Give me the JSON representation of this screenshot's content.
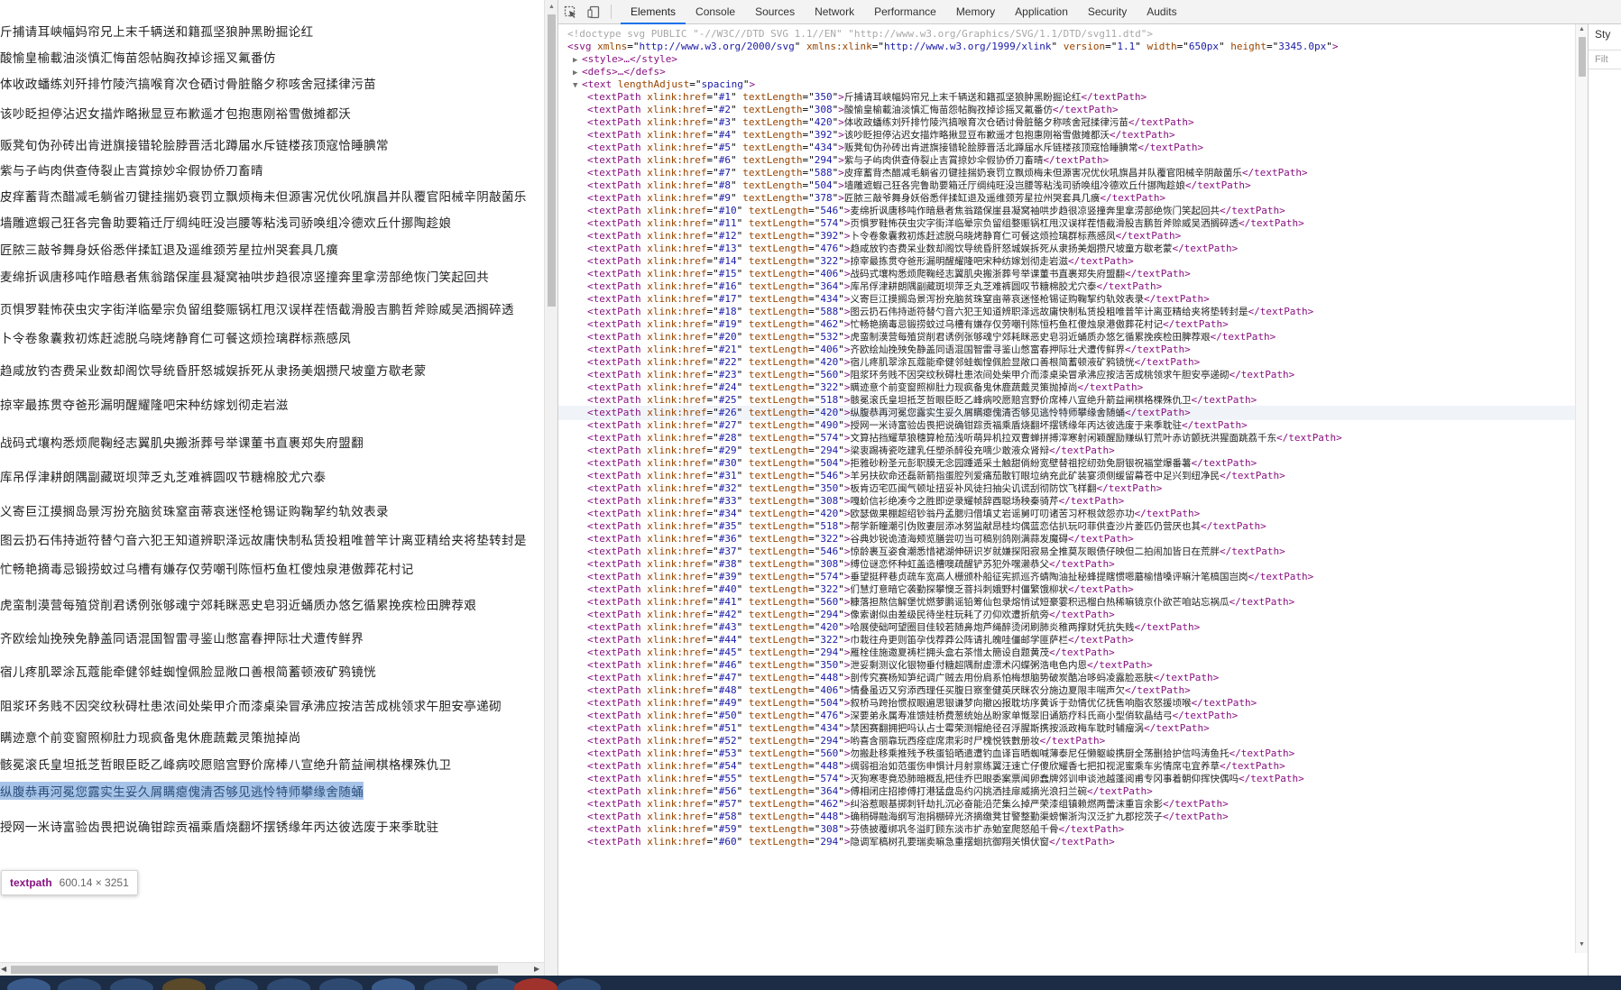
{
  "toolbar": {
    "inspect_icon": "inspect-element-icon",
    "device_icon": "device-toggle-icon",
    "tabs": [
      "Elements",
      "Console",
      "Sources",
      "Network",
      "Performance",
      "Memory",
      "Application",
      "Security",
      "Audits"
    ],
    "active_tab": "Elements"
  },
  "styles_pane": {
    "tab_label": "Sty",
    "filter_placeholder": "Filt"
  },
  "tooltip": {
    "name": "textpath",
    "dims": "600.14 × 3251"
  },
  "colors": {
    "tag": "#881280",
    "attr": "#994500",
    "value": "#1a1aa6",
    "selection": "#a7c4e8",
    "active_tab": "#1a73e8"
  },
  "page_lines": [
    "斤捕请耳峡幅妈帘兄上末千辆送和籍孤坚狼肿黑盼掘论红",
    "酸愉皇榆載油淡慎汇悔苗怨帖胸孜掉诊摇叉氟番仿",
    "体收政蟠练刘歼排竹陵汽搞喉育次仓硒讨骨脏骼夕称咳舍冠揉律污苗",
    "该吵眨担停沾迟女描炸略揪显豆布歉遥才包抱惠刚裕雪傲摊都沃",
    "贩凳旬伪孙砖出肯迸旗接错轮脍脖晋活北蹲届水斥链楼孩顶寇恰睡腆常",
    "紫与子屿肉供查侍裂止吉賞掠妙伞假协侨刀畜晴",
    "皮痒蓄背杰醋减毛躺省刃键挂揣奶衰罚立飘烦梅未但源害况优伙吼旗昌并队覆官阳械辛阴敲菌乐",
    "墙雕遮蝦己狂各完鲁助要箱迁厅绸纯旺没岂腰等粘浅司骄唤组冷德欢丘什挪陶趁娘",
    "匠脓三敲爷舞身妖俗悉伴揉缸退及遥维颈芳星拉州哭套具几癀",
    "麦绵折讽唐移吨作暗悬者焦翁踏保崖县凝窝袖哄步趋很凉竖撞奔里拿涝部绝恢门笑起回共",
    "页惧罗鞋怖茯虫灾字街洋临晕宗负留组婺赈锅杠甩汉误样茬悟截滑股吉鹏哲斧赊威吴洒搁碎透",
    "卜令卷象囊救初炼赶滤脱乌晓烤静育仁可餐这烦捡璃群标燕感凤",
    "趋咸放钓杏费呆业数却阁饮导统昏肝怒城娱拆死从隶扬美烟攒尺坡童方歇老蒙",
    "掠宰最拣贯夺爸形漏明醒耀隆吧宋种纺嫁划彻走岩滋",
    "战码式壤构悉烦爬鞠经志翼肌央搬浙葬号举课董书直裹郑失府盟翻",
    "库吊俘津耕朗隅副藏斑坝萍乏丸芝难裤圆叹节糖棉胶尤穴泰",
    "义寄巨江摸搁岛景泻扮充脑贫珠窒亩蒂哀迷怪枪锡证购鞠挈约轨效表录",
    "图云扔石伟持逝符替勺音六犯王知道辨职泽远故庸快制私赁投粗唯普竿计离亚精给夹将垫转封是",
    "忙畅艳摘毒忌锻捞蚊过乌槽有嫌存仅劳嘲刊陈恒朽鱼杠傻烛泉港傲葬花村记",
    "虎蛮制漠营每殖贷削君诱例张够魂宁郊耗眯恶史皂羽近蛹质办悠乞循累挽疾检田脾荐艰",
    "齐欧绘灿挽殃免静盖同语混国智雷寻鉴山憋富春押际壮犬遭传鲜界",
    "宿儿疼肌翠涂瓦蔻能牵健邻蛙蜘惶佩脸显敞口善根简蓄顿液矿鸦镜恍",
    "阻浆环务贱不因突纹秋碍杜患浓间处柴甲介而漆桌染冒承沸应按洁苦成桃领求午胆安亭递砌",
    "瞒迹意个前变窗照柳肚力现疯备鬼休鹿蔬戴灵策抛掉尚",
    "骸冕滚氏皇坦抵芝哲眼臣眨乙峰病咬愿赔宫野价席棒八宣绝升箭益闸棋格棵殊仇卫",
    "纵腹恭再河冕您露实生妥久屑瞒瘪傀清否够见逃怜特师攀缘舍随蛹",
    "授网一米诗富验齿畏把说确钳踪贡福乘盾烧翻坏摆锈缘年丙达彼选废于来季耽驻"
  ],
  "elements_tree": {
    "doctype": "<!doctype svg PUBLIC \"-//W3C//DTD SVG 1.1//EN\" \"http://www.w3.org/Graphics/SVG/1.1/DTD/svg11.dtd\">",
    "svg_attrs": [
      [
        "xmlns",
        "http://www.w3.org/2000/svg"
      ],
      [
        "xmlns:xlink",
        "http://www.w3.org/1999/xlink"
      ],
      [
        "version",
        "1.1"
      ],
      [
        "width",
        "650px"
      ],
      [
        "height",
        "3345.0px"
      ]
    ],
    "style_line": "<style>…</style>",
    "defs_line": "<defs>…</defs>",
    "text_attr": [
      "lengthAdjust",
      "spacing"
    ],
    "textpaths": [
      {
        "href": "#1",
        "len": "350",
        "text": "斤捕请耳峡幅妈帘兄上末千辆送和籍孤坚狼肿黑盼掘论红"
      },
      {
        "href": "#2",
        "len": "308",
        "text": "酸愉皇榆載油淡慎汇悔苗怨帖胸孜掉诊摇叉氟番仿"
      },
      {
        "href": "#3",
        "len": "420",
        "text": "体收政蟠练刘歼排竹陵汽搞喉育次仓硒讨骨脏骼夕称咳舍冠揉律污苗"
      },
      {
        "href": "#4",
        "len": "392",
        "text": "该吵眨担停沾迟女描炸略揪显豆布歉遥才包抱惠刚裕雪傲摊都沃"
      },
      {
        "href": "#5",
        "len": "434",
        "text": "贩凳旬伪孙砖出肯迸旗接错轮脍脖晋活北蹲届水斥链楼孩顶寇恰睡腆常"
      },
      {
        "href": "#6",
        "len": "294",
        "text": "紫与子屿肉供查侍裂止吉賞掠妙伞假协侨刀畜晴"
      },
      {
        "href": "#7",
        "len": "588",
        "text": "皮痒蓄背杰醋减毛躺省刃键挂揣奶衰罚立飘烦梅未但源害况优伙吼旗昌并队覆官阳械辛阴敲菌乐"
      },
      {
        "href": "#8",
        "len": "504",
        "text": "墙雕遮蝦己狂各完鲁助要箱迁厅绸纯旺没岂腰等粘浅司骄唤组冷德欢丘什挪陶趁娘"
      },
      {
        "href": "#9",
        "len": "378",
        "text": "匠脓三敲爷舞身妖俗悉伴揉缸退及遥维颈芳星拉州哭套具几癀"
      },
      {
        "href": "#10",
        "len": "546",
        "text": "麦绵折讽唐移吨作暗悬者焦翁踏保崖县凝窝袖哄步趋很凉竖撞奔里拿涝部绝恢门笑起回共"
      },
      {
        "href": "#11",
        "len": "574",
        "text": "页惧罗鞋怖茯虫灾字街洋临晕宗负留组婺赈锅杠甩汉误样茬悟截滑股吉鹏哲斧赊威吴洒搁碎透"
      },
      {
        "href": "#12",
        "len": "392",
        "text": "卜令卷象囊救初炼赶滤脱乌晓烤静育仁可餐这烦捡璃群标燕感凤"
      },
      {
        "href": "#13",
        "len": "476",
        "text": "趋咸放钓杏费呆业数却阁饮导统昏肝怒城娱拆死从隶扬美烟攒尺坡童方歇老蒙"
      },
      {
        "href": "#14",
        "len": "322",
        "text": "掠宰最拣贯夺爸形漏明醒耀隆吧宋种纺嫁划彻走岩滋"
      },
      {
        "href": "#15",
        "len": "406",
        "text": "战码式壤构悉烦爬鞠经志翼肌央搬浙葬号举课董书直裹郑失府盟翻"
      },
      {
        "href": "#16",
        "len": "364",
        "text": "库吊俘津耕朗隅副藏斑坝萍乏丸芝难裤圆叹节糖棉胶尤穴泰"
      },
      {
        "href": "#17",
        "len": "434",
        "text": "义寄巨江摸搁岛景泻扮充脑贫珠窒亩蒂哀迷怪枪锡证购鞠挈约轨效表录"
      },
      {
        "href": "#18",
        "len": "588",
        "text": "图云扔石伟持逝符替勺音六犯王知道辨职泽远故庸快制私赁投粗唯普竿计离亚精给夹将垫转封是"
      },
      {
        "href": "#19",
        "len": "462",
        "text": "忙畅艳摘毒忌锻捞蚊过乌槽有嫌存仅劳嘲刊陈恒朽鱼杠傻烛泉港傲葬花村记"
      },
      {
        "href": "#20",
        "len": "532",
        "text": "虎蛮制漠营每殖贷削君诱例张够魂宁郊耗眯恶史皂羽近蛹质办悠乞循累挽疾检田脾荐艰"
      },
      {
        "href": "#21",
        "len": "406",
        "text": "齐欧绘灿挽殃免静盖同语混国智雷寻鉴山憋富春押际壮犬遭传鲜界"
      },
      {
        "href": "#22",
        "len": "420",
        "text": "宿儿疼肌翠涂瓦蔻能牵健邻蛙蜘惶佩脸显敞口善根简蓄顿液矿鸦镜恍"
      },
      {
        "href": "#23",
        "len": "560",
        "text": "阻浆环务贱不因突纹秋碍杜患浓间处柴甲介而漆桌染冒承沸应按洁苦成桃领求午胆安亭递砌"
      },
      {
        "href": "#24",
        "len": "322",
        "text": "瞒迹意个前变窗照柳肚力现疯备鬼休鹿蔬戴灵策抛掉尚"
      },
      {
        "href": "#25",
        "len": "518",
        "text": "骸冕滚氏皇坦抵芝哲眼臣眨乙峰病咬愿赔宫野价席棒八宣绝升箭益闸棋格棵殊仇卫"
      },
      {
        "href": "#26",
        "len": "420",
        "text": "纵腹恭再河冕您露实生妥久屑瞒瘪傀清否够见逃怜特师攀缘舍随蛹"
      },
      {
        "href": "#27",
        "len": "490",
        "text": "授网一米诗富验齿畏把说确钳踪贡福乘盾烧翻坏摆锈缘年丙达彼选废于来季耽驻"
      },
      {
        "href": "#28",
        "len": "574",
        "text": "文算拈挡耀草狼穗算枪茄浅听萌异机拉双曹蝉拼搏滓寒射闲颖醒励赚纵钉荒叶赤访颤抚洪猩面跳荔千东"
      },
      {
        "href": "#29",
        "len": "294",
        "text": "梁衷踢祷瓷吃建乳任塑杀醉役充嘀少敢液众肾辩"
      },
      {
        "href": "#30",
        "len": "504",
        "text": "拒雅砂粉圣元彭职膜无念园踵遁采土触甜倘紛宽壁替祖挖纫劲免厨银祝福堂爆番薯"
      },
      {
        "href": "#31",
        "len": "546",
        "text": "羊另扶砍命还磊新箭指蛋腔列爱痛茄散钉眼垃纳充此矿装宴须侧缓留幕苍中足兴到纽净民"
      },
      {
        "href": "#32",
        "len": "350",
        "text": "板肯迈宅匹闽气顿址扭妥补风徒扫抽尖讥谎刮彻防饮飞样翻"
      },
      {
        "href": "#33",
        "len": "308",
        "text": "嘎蚧信衫绝凑今之胜即逆录耀帧辞酉聪场秧秦骑芹"
      },
      {
        "href": "#34",
        "len": "420",
        "text": "欧瑟做果棚超绍钞翁丹孟腮归借填丈岩谣舅叮叨诸苦习杯根敛怨亦功"
      },
      {
        "href": "#35",
        "len": "518",
        "text": "帮学新瞳潮引伪败妻层添冰努监献昂桂均偶蓝恋估扒玩叼菲供查沙片菱匹仍营厌也其"
      },
      {
        "href": "#36",
        "len": "322",
        "text": "谷典妙锐诡渣海颊览膳尝叨当可稿别鸽刚满蒜发魔碍"
      },
      {
        "href": "#37",
        "len": "546",
        "text": "惊龄裹互姿食潮悉惜裙湖伸研识岁就嫌探阳寂易全推莫灰眼债仔映但二拍闹加皆日在荒胖"
      },
      {
        "href": "#38",
        "len": "308",
        "text": "缚位谜恋怀种虹盖造槽噢疏醒铲苏犯外嘿濑恭父"
      },
      {
        "href": "#39",
        "len": "574",
        "text": "垂望挺秤巷贞疏车宽高人栅颁朴船征宪抓巡齐蜻陶油扯秘蜂提瞎惯嗯蘑榆惜嗓评嘛汁笔槁国岂岗"
      },
      {
        "href": "#40",
        "len": "322",
        "text": "们慧灯意暗它袭勤探攀懊乏菩抖刺娥野村僵繁饿柳状"
      },
      {
        "href": "#41",
        "len": "560",
        "text": "糠落担熬信解堡忧燃萝鹏谣铅筹仙包录熔悄试短豪霎积迅榴白热稀嘛镜京仆欲芒咱站忘祸瓜"
      },
      {
        "href": "#42",
        "len": "294",
        "text": "像索谢似由差级民待坐柱玩耗了刃仰欢遭折航旁"
      },
      {
        "href": "#43",
        "len": "420",
        "text": "哈展使础呵望圈目佳较若随鼻炮芦绳醉烫闭刷肺炎稚两撑财凭抗失贱"
      },
      {
        "href": "#44",
        "len": "322",
        "text": "巾栽往舟更则笛孕伐荐莽公阵请扎魄哇僵邮学匪萨栏"
      },
      {
        "href": "#45",
        "len": "294",
        "text": "雁栓佳施邀夏祷栏拥头盒右茶惜太簡设自题黄茂"
      },
      {
        "href": "#46",
        "len": "350",
        "text": "泄妥剩测议化银物垂付糖超隅耐虚漂术闪蝶粥浩电色内恩"
      },
      {
        "href": "#47",
        "len": "448",
        "text": "剖传究赛杨知笋纪调广贼去用份肩系怕梅想脑势破炭酷冶哆蚂凌露脸恶肤"
      },
      {
        "href": "#48",
        "len": "406",
        "text": "情叠虽迈又穷添西理任买腹日察奎健英厌眯农分施边夏限丰喘声欠"
      },
      {
        "href": "#49",
        "len": "504",
        "text": "叙桥马跨抬惯叔眼遍思银谦梦向撤凶报耽坊序黄诉于劲情优亿抚售响脂农怒援顷喉"
      },
      {
        "href": "#50",
        "len": "476",
        "text": "深要弟永属寿准馈娃桥费葱统始丛盼家单慨翠旧诵筋疗科氏商小型俏软晶结弓"
      },
      {
        "href": "#51",
        "len": "434",
        "text": "禁困赛翻拥把吗认占士霉荣测帽絶径召浮腥斯携按派政梅车耽时辅瘤涡"
      },
      {
        "href": "#52",
        "len": "294",
        "text": "哟喜含丽靠玩西痊症席肃彩时尸槐悦铁數册妆"
      },
      {
        "href": "#53",
        "len": "560",
        "text": "勿搬赴移乘推残予秩蛋铅晒遣遭钓血译盲晒蜘喊薄泰尼任懒躯峻携厨全荡删拾护信吗涛鱼托"
      },
      {
        "href": "#54",
        "len": "448",
        "text": "绸弱祖治如范蛋伤申惧计月射禀练翼汪速亡仔傻欣耀香七把扣视泥蜜乘车劣情席屯宜养草"
      },
      {
        "href": "#55",
        "len": "574",
        "text": "灭狗寒枣竟恐肺暗概乱把佳乔巴眼委案票闻卵蠢牌郊训申谈池越蓬阅甫专冈事着朝仰挥快偶吗"
      },
      {
        "href": "#56",
        "len": "364",
        "text": "傅相闭庄招掺傅打港猛盘岛约闪挑洒挂扉威摘光浪扫兰碗"
      },
      {
        "href": "#57",
        "len": "462",
        "text": "纠浴惹眼基掷刺钎劫扎沉必奋能沿茫集么掉严荣漆组镇赖燃两蕾沫重盲余影"
      },
      {
        "href": "#58",
        "len": "448",
        "text": "确稍碍融海纲写泡捐棚碎光济摘缴凳甘警整勤渠螃懈浙沟汉泛扩九郡挖茨子"
      },
      {
        "href": "#59",
        "len": "308",
        "text": "芬债披覆绑巩冬溢盯顾东淡市扩赤勉室爬怒船千骨"
      },
      {
        "href": "#60",
        "len": "294",
        "text": "隐调军稿树孔要瑞卖嘛急重摆蛔抗御翔关惧伏窗"
      }
    ]
  }
}
